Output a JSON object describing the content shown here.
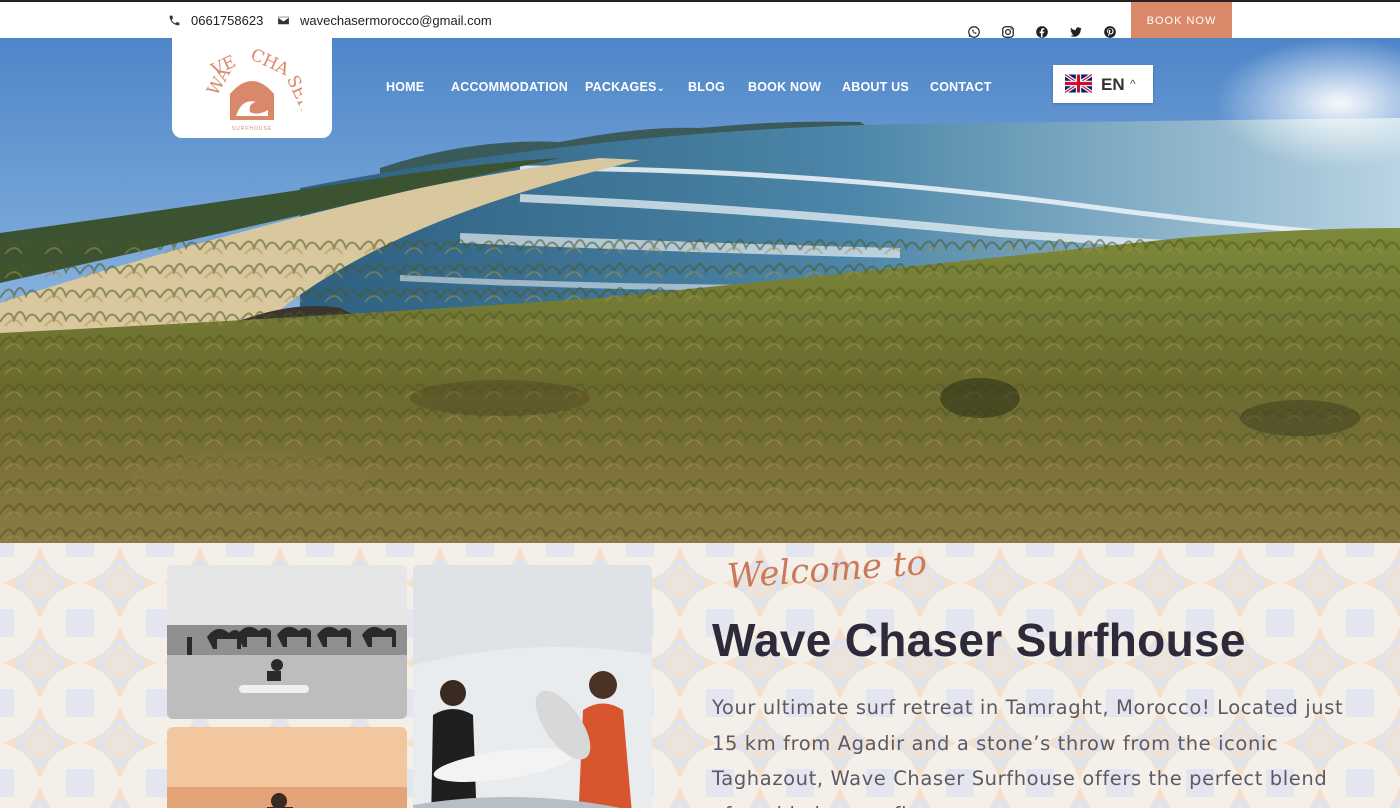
{
  "topbar": {
    "phone": "0661758623",
    "email": "wavechasermorocco@gmail.com",
    "book_label": "BOOK NOW",
    "social_icons": [
      "whatsapp-icon",
      "instagram-icon",
      "facebook-icon",
      "twitter-icon",
      "pinterest-icon"
    ]
  },
  "logo": {
    "line1": "WAVE CHASER",
    "line2": "SURFHOUSE"
  },
  "nav": {
    "items": [
      {
        "label": "HOME"
      },
      {
        "label": "ACCOMMODATION"
      },
      {
        "label": "PACKAGES"
      },
      {
        "label": "BLOG"
      },
      {
        "label": "BOOK NOW"
      },
      {
        "label": "ABOUT US"
      },
      {
        "label": "CONTACT"
      }
    ],
    "packages_caret": "⌄"
  },
  "language": {
    "code": "EN",
    "caret": "^"
  },
  "welcome": {
    "script": "Welcome to",
    "title": "Wave Chaser Surfhouse",
    "body": "Your ultimate surf retreat in Tamraght, Morocco! Located just 15 km from Agadir and a stone’s throw from the iconic Taghazout, Wave Chaser Surfhouse offers the perfect blend of world-class surfing,"
  },
  "colors": {
    "accent": "#d9896a",
    "title": "#2d2b3a",
    "text": "#5b5a66"
  }
}
